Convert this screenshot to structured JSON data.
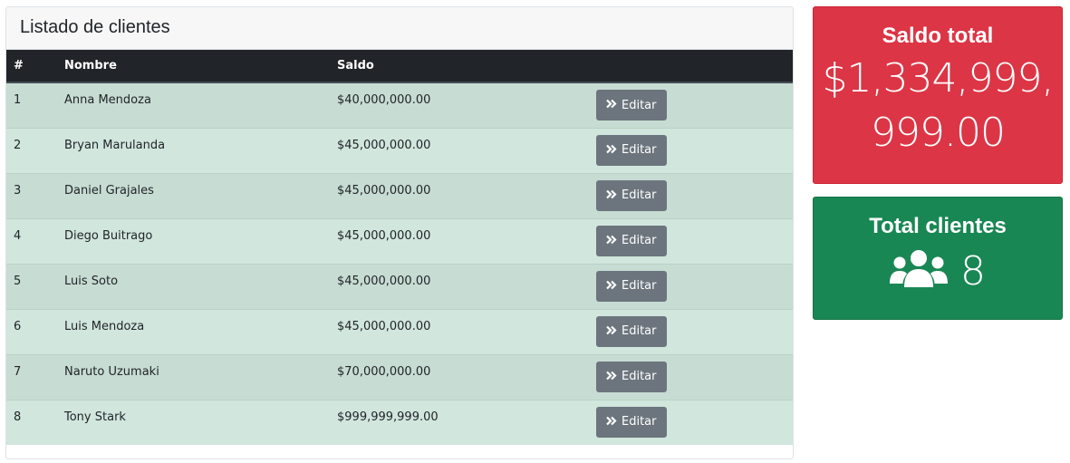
{
  "list": {
    "title": "Listado de clientes",
    "columns": [
      "#",
      "Nombre",
      "Saldo",
      ""
    ],
    "rows": [
      {
        "id": "1",
        "name": "Anna Mendoza",
        "saldo": "$40,000,000.00",
        "action": "Editar"
      },
      {
        "id": "2",
        "name": "Bryan Marulanda",
        "saldo": "$45,000,000.00",
        "action": "Editar"
      },
      {
        "id": "3",
        "name": "Daniel Grajales",
        "saldo": "$45,000,000.00",
        "action": "Editar"
      },
      {
        "id": "4",
        "name": "Diego Buitrago",
        "saldo": "$45,000,000.00",
        "action": "Editar"
      },
      {
        "id": "5",
        "name": "Luis Soto",
        "saldo": "$45,000,000.00",
        "action": "Editar"
      },
      {
        "id": "6",
        "name": "Luis Mendoza",
        "saldo": "$45,000,000.00",
        "action": "Editar"
      },
      {
        "id": "7",
        "name": "Naruto Uzumaki",
        "saldo": "$70,000,000.00",
        "action": "Editar"
      },
      {
        "id": "8",
        "name": "Tony Stark",
        "saldo": "$999,999,999.00",
        "action": "Editar"
      }
    ],
    "edit_icon": "angle-double-right-icon"
  },
  "saldo_card": {
    "title": "Saldo total",
    "value_line1": "$1,334,999,",
    "value_line2": "999.00",
    "color": "#dc3545"
  },
  "clientes_card": {
    "title": "Total clientes",
    "icon": "users-icon",
    "count": "8",
    "color": "#198754"
  }
}
